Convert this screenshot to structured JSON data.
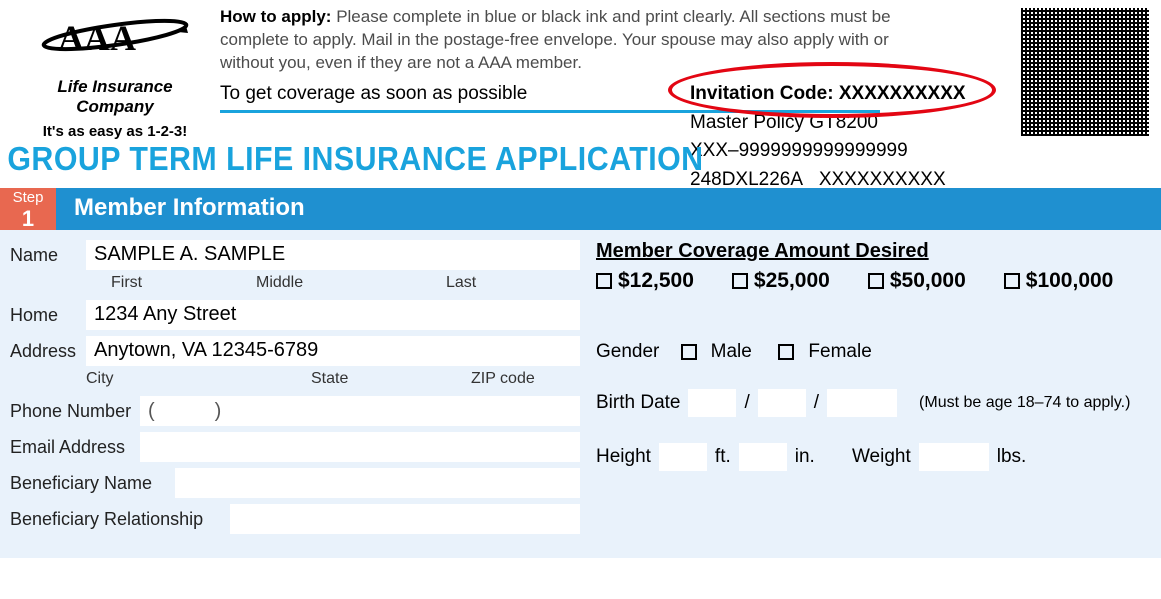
{
  "logo": {
    "company1": "Life Insurance",
    "company2": "Company",
    "tagline": "It's as easy as 1-2-3!"
  },
  "howto": {
    "label": "How to apply:",
    "text": "Please complete in blue or black ink and print clearly. All sections must be complete to apply. Mail in the postage-free envelope. Your spouse may also apply with or without you, even if they are not a AAA member.",
    "soon": "To get coverage as soon as possible"
  },
  "codes": {
    "inv_label": "Invitation Code:",
    "inv_value": "XXXXXXXXXX",
    "policy": "Master Policy GT8200",
    "line3": "XXX–9999999999999999",
    "line4a": "248DXL226A",
    "line4b": "XXXXXXXXXX"
  },
  "title": "GROUP TERM LIFE INSURANCE APPLICATION",
  "step": {
    "label": "Step",
    "num": "1",
    "title": "Member Information"
  },
  "labels": {
    "name": "Name",
    "first": "First",
    "middle": "Middle",
    "last": "Last",
    "home": "Home",
    "address": "Address",
    "city": "City",
    "state": "State",
    "zip": "ZIP code",
    "phone": "Phone Number",
    "email": "Email Address",
    "bname": "Beneficiary Name",
    "brel": "Beneficiary Relationship",
    "paren_l": "(",
    "paren_r": ")"
  },
  "values": {
    "name": "SAMPLE A. SAMPLE",
    "street": "1234 Any Street",
    "citystate": "Anytown, VA 12345-6789"
  },
  "right": {
    "cov_head": "Member Coverage Amount Desired",
    "amounts": [
      "$12,500",
      "$25,000",
      "$50,000",
      "$100,000"
    ],
    "gender": "Gender",
    "male": "Male",
    "female": "Female",
    "birth": "Birth Date",
    "slash": "/",
    "note": "(Must be age 18–74 to apply.)",
    "height": "Height",
    "ft": "ft.",
    "in": "in.",
    "weight": "Weight",
    "lbs": "lbs."
  }
}
